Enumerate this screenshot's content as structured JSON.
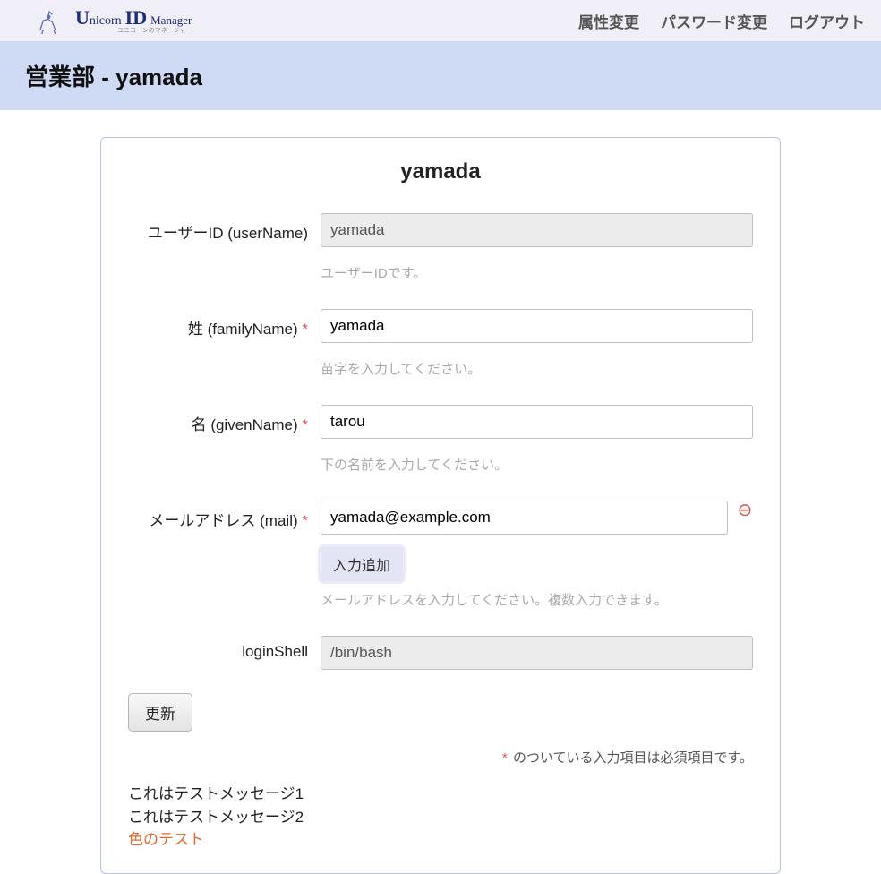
{
  "app": {
    "logo_text1": "U",
    "logo_text2": "nicorn",
    "logo_text3": "ID",
    "logo_text4": "Manager",
    "logo_sub": "ユニコーンのマネージャー"
  },
  "nav": {
    "attr_change": "属性変更",
    "password_change": "パスワード変更",
    "logout": "ログアウト"
  },
  "page": {
    "title": "営業部 - yamada",
    "heading": "yamada"
  },
  "form": {
    "userName": {
      "label": "ユーザーID (userName)",
      "value": "yamada",
      "helper": "ユーザーIDです。"
    },
    "familyName": {
      "label": "姓 (familyName)",
      "value": "yamada",
      "helper": "苗字を入力してください。"
    },
    "givenName": {
      "label": "名 (givenName)",
      "value": "tarou",
      "helper": "下の名前を入力してください。"
    },
    "mail": {
      "label": "メールアドレス (mail)",
      "value": "yamada@example.com",
      "add_label": "入力追加",
      "helper": "メールアドレスを入力してください。複数入力できます。"
    },
    "loginShell": {
      "label": "loginShell",
      "value": "/bin/bash"
    },
    "update_label": "更新",
    "required_note": "のついている入力項目は必須項目です。",
    "required_mark": "*"
  },
  "messages": {
    "m1": "これはテストメッセージ1",
    "m2": "これはテストメッセージ2",
    "m3": "色のテスト"
  }
}
